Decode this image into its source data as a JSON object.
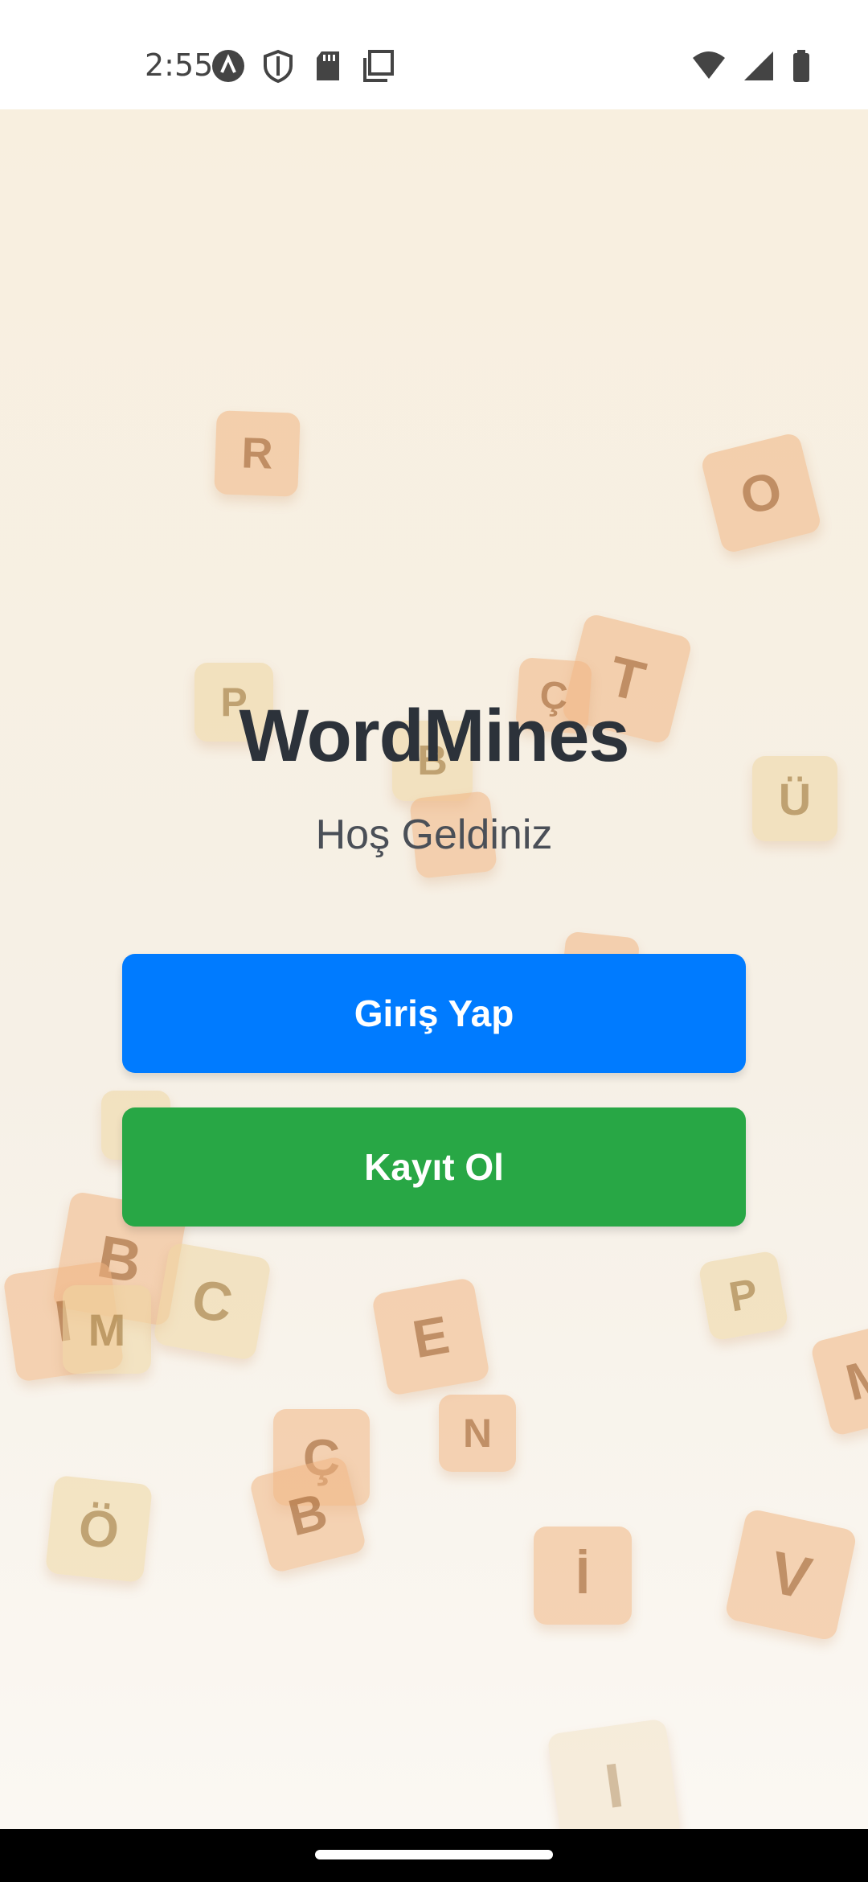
{
  "status_bar": {
    "time": "2:55",
    "left_icons": [
      "app-a-icon",
      "shield-icon",
      "sd-card-icon",
      "copy-icon"
    ],
    "right_icons": [
      "wifi-icon",
      "signal-icon",
      "battery-icon"
    ]
  },
  "app": {
    "title": "WordMines",
    "subtitle": "Hoş Geldiniz"
  },
  "buttons": {
    "login": "Giriş Yap",
    "register": "Kayıt Ol"
  },
  "background_tiles": {
    "r1": "R",
    "o1": "O",
    "t1": "T",
    "c_cedilla1": "Ç",
    "p1": "P",
    "b1": "B",
    "u_umlaut1": "Ü",
    "b2": "B",
    "i1": "I",
    "m1": "M",
    "c1": "C",
    "e1": "E",
    "p2": "P",
    "m2": "M",
    "n1": "N",
    "c_cedilla2": "Ç",
    "b3": "B",
    "o_umlaut1": "Ö",
    "i_dot1": "İ",
    "v1": "V",
    "i2": "I"
  },
  "colors": {
    "login_button": "#007bff",
    "register_button": "#28a745",
    "title_text": "#2c323a"
  }
}
